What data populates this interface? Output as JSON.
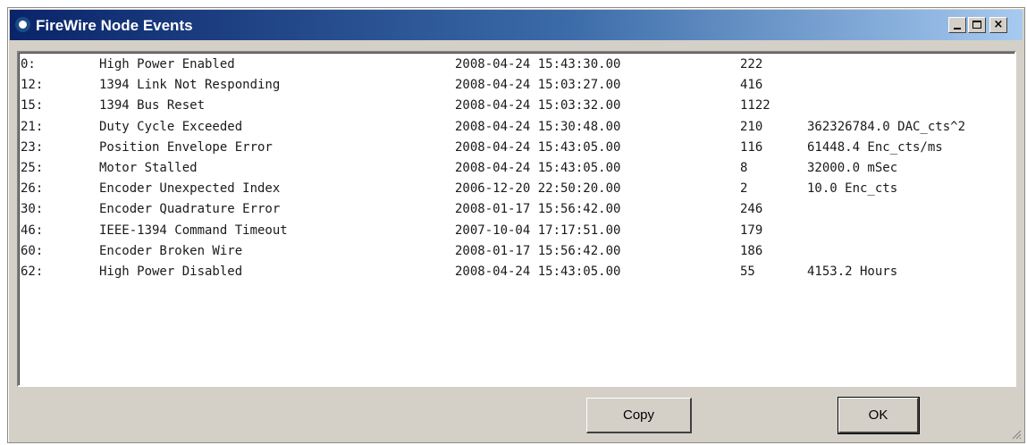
{
  "window": {
    "title": "FireWire Node Events",
    "controls": {
      "minimize_icon": "minimize-icon",
      "maximize_icon": "maximize-icon",
      "close_icon": "close-icon",
      "close_glyph": "×"
    }
  },
  "events": [
    {
      "id": "0:",
      "name": "High Power Enabled",
      "time": "2008-04-24 15:43:30.00",
      "count": "222",
      "extra": ""
    },
    {
      "id": "12:",
      "name": "1394 Link Not Responding",
      "time": "2008-04-24 15:03:27.00",
      "count": "416",
      "extra": ""
    },
    {
      "id": "15:",
      "name": "1394 Bus Reset",
      "time": "2008-04-24 15:03:32.00",
      "count": "1122",
      "extra": ""
    },
    {
      "id": "21:",
      "name": "Duty Cycle Exceeded",
      "time": "2008-04-24 15:30:48.00",
      "count": "210",
      "extra": "362326784.0 DAC_cts^2"
    },
    {
      "id": "23:",
      "name": "Position Envelope Error",
      "time": "2008-04-24 15:43:05.00",
      "count": "116",
      "extra": "61448.4 Enc_cts/ms"
    },
    {
      "id": "25:",
      "name": "Motor Stalled",
      "time": "2008-04-24 15:43:05.00",
      "count": "8",
      "extra": "32000.0 mSec"
    },
    {
      "id": "26:",
      "name": "Encoder Unexpected Index",
      "time": "2006-12-20 22:50:20.00",
      "count": "2",
      "extra": "10.0 Enc_cts"
    },
    {
      "id": "30:",
      "name": "Encoder Quadrature Error",
      "time": "2008-01-17 15:56:42.00",
      "count": "246",
      "extra": ""
    },
    {
      "id": "46:",
      "name": "IEEE-1394 Command Timeout",
      "time": "2007-10-04 17:17:51.00",
      "count": "179",
      "extra": ""
    },
    {
      "id": "60:",
      "name": "Encoder Broken Wire",
      "time": "2008-01-17 15:56:42.00",
      "count": "186",
      "extra": ""
    },
    {
      "id": "62:",
      "name": "High Power Disabled",
      "time": "2008-04-24 15:43:05.00",
      "count": "55",
      "extra": "4153.2 Hours"
    }
  ],
  "buttons": {
    "copy_label": "Copy",
    "ok_label": "OK"
  },
  "icons": {
    "app_icon": "app-icon",
    "resize_grip": "resize-grip-icon"
  }
}
